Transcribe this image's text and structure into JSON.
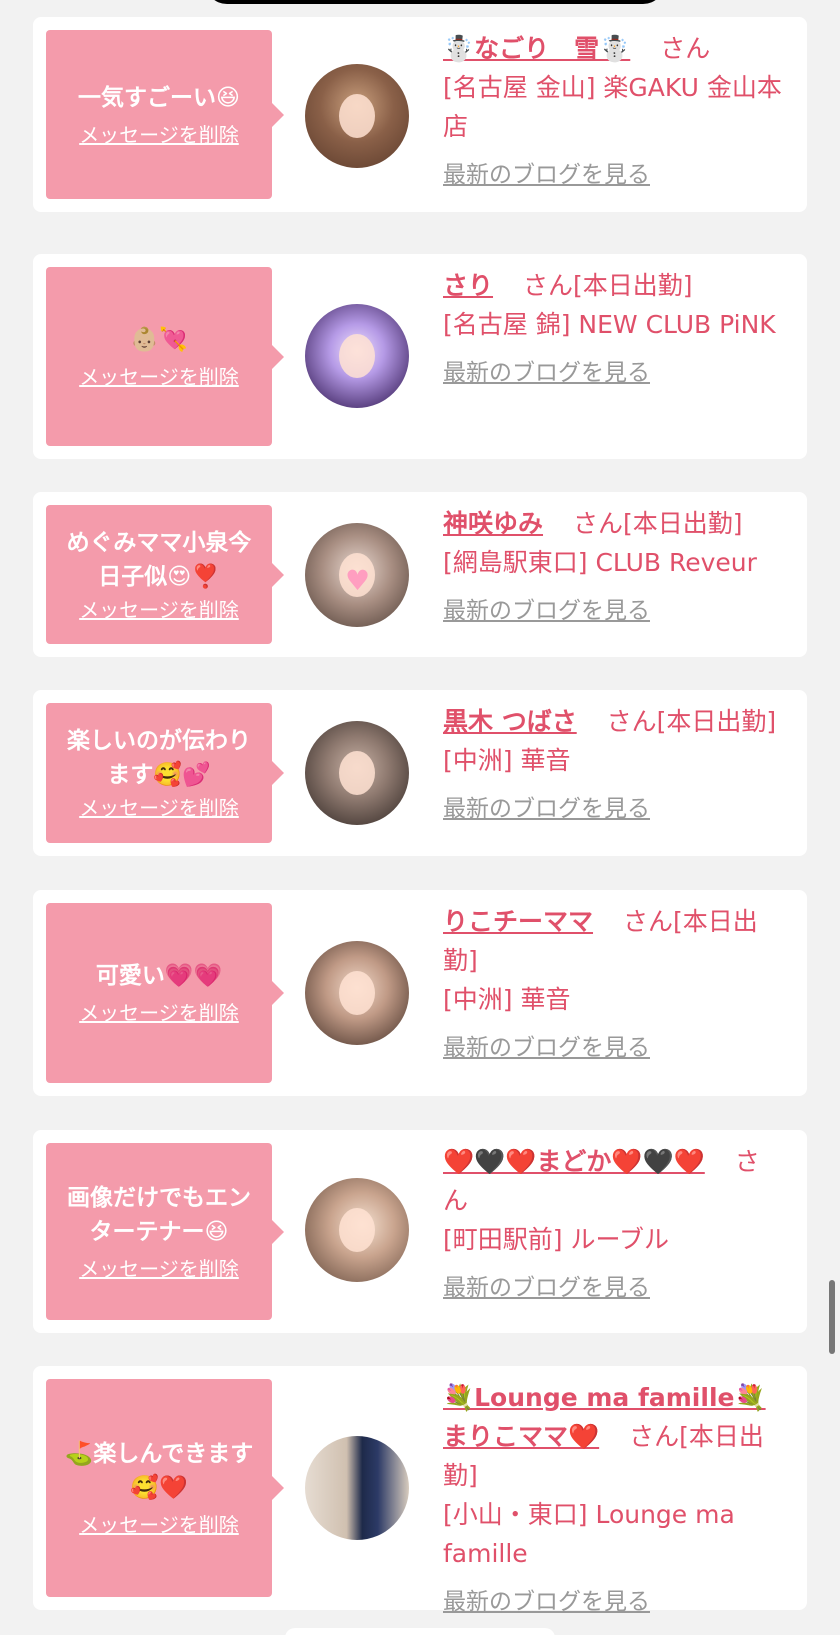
{
  "delete_label": "メッセージを削除",
  "blog_label": "最新のブログを見る",
  "san_label": "さん",
  "cards": [
    {
      "message": "一気すごーい😆",
      "name": "☃️なごり　雪☃️",
      "suffix": "さん",
      "shop": "[名古屋 金山] 楽GAKU 金山本店",
      "avatar_colors": [
        "#caa07e",
        "#5a3a2a"
      ]
    },
    {
      "message": "👶🏼💘",
      "name": "さり",
      "suffix": "さん[本日出勤]",
      "shop": "[名古屋 錦] NEW CLUB PiNK",
      "avatar_colors": [
        "#c9b3f0",
        "#3a2a4a"
      ]
    },
    {
      "message": "めぐみママ小泉今日子似😍❣️",
      "name": "神咲ゆみ",
      "suffix": "さん[本日出勤]",
      "shop": "[網島駅東口] CLUB Reveur",
      "avatar_colors": [
        "#d9c7be",
        "#4a3a32"
      ]
    },
    {
      "message": "楽しいのが伝わります🥰💕",
      "name": "黒木 つばさ",
      "suffix": "さん[本日出勤]",
      "shop": "[中洲] 華音",
      "avatar_colors": [
        "#8f7a70",
        "#2a221f"
      ]
    },
    {
      "message": "可愛い💗💗",
      "name": "りこチーママ",
      "suffix": "さん[本日出勤]",
      "shop": "[中洲] 華音",
      "avatar_colors": [
        "#d8b7a4",
        "#3d2a22"
      ]
    },
    {
      "message": "画像だけでもエンターテナー😆",
      "name": "❤️🖤❤️まどか❤️🖤❤️",
      "suffix": "さん",
      "shop": "[町田駅前] ルーブル",
      "avatar_colors": [
        "#e4c7b5",
        "#5c4437"
      ]
    },
    {
      "message": "⛳️楽しんできます🥰❤️",
      "name": "💐Lounge ma famille💐まりこママ❤️",
      "suffix": "さん[本日出勤]",
      "shop": "[小山・東口] Lounge ma famille",
      "avatar_colors": [
        "#d0c0b0",
        "#1e2a4a"
      ]
    }
  ]
}
